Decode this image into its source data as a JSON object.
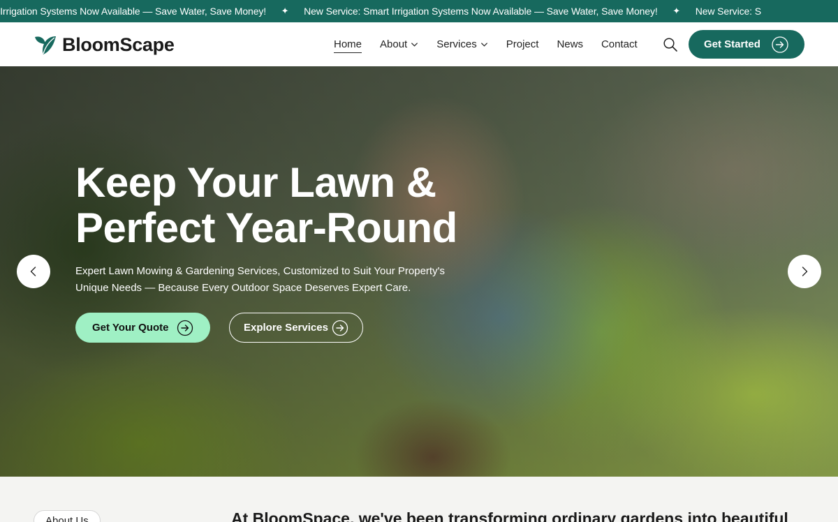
{
  "ticker": {
    "items": [
      "rt Irrigation Systems Now Available — Save Water, Save Money!",
      "New Service: Smart Irrigation Systems Now Available — Save Water, Save Money!",
      "New Service: S"
    ],
    "separator": "✦"
  },
  "header": {
    "brand": "BloomScape",
    "nav": [
      {
        "label": "Home",
        "active": true
      },
      {
        "label": "About",
        "dropdown": true
      },
      {
        "label": "Services",
        "dropdown": true
      },
      {
        "label": "Project"
      },
      {
        "label": "News"
      },
      {
        "label": "Contact"
      }
    ],
    "search_icon": "search-icon",
    "cta_label": "Get Started"
  },
  "hero": {
    "title_line1": "Keep Your Lawn &",
    "title_line2": "Perfect Year-Round",
    "subtitle_line1": "Expert Lawn Mowing & Gardening Services, Customized to Suit Your Property's",
    "subtitle_line2": "Unique Needs — Because Every Outdoor Space Deserves Expert Care.",
    "primary_button": "Get Your Quote",
    "secondary_button": "Explore Services"
  },
  "about": {
    "badge": "About Us",
    "lead": "At BloomSpace, we've been transforming ordinary gardens into beautiful"
  },
  "colors": {
    "brand": "#17695e",
    "accent": "#9ff0c4"
  }
}
